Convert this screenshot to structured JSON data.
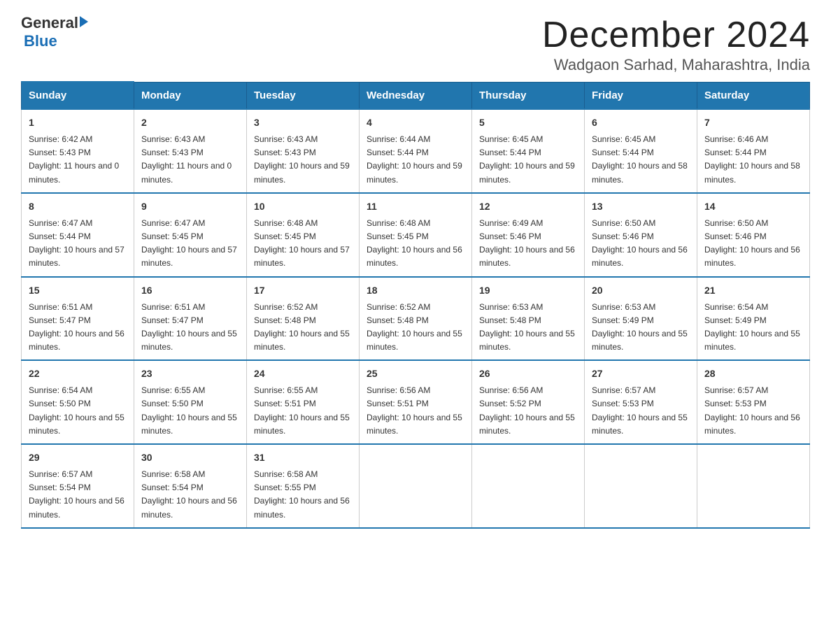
{
  "logo": {
    "general": "General",
    "blue": "Blue"
  },
  "title": "December 2024",
  "subtitle": "Wadgaon Sarhad, Maharashtra, India",
  "days_of_week": [
    "Sunday",
    "Monday",
    "Tuesday",
    "Wednesday",
    "Thursday",
    "Friday",
    "Saturday"
  ],
  "weeks": [
    [
      {
        "day": "1",
        "sunrise": "6:42 AM",
        "sunset": "5:43 PM",
        "daylight": "11 hours and 0 minutes."
      },
      {
        "day": "2",
        "sunrise": "6:43 AM",
        "sunset": "5:43 PM",
        "daylight": "11 hours and 0 minutes."
      },
      {
        "day": "3",
        "sunrise": "6:43 AM",
        "sunset": "5:43 PM",
        "daylight": "10 hours and 59 minutes."
      },
      {
        "day": "4",
        "sunrise": "6:44 AM",
        "sunset": "5:44 PM",
        "daylight": "10 hours and 59 minutes."
      },
      {
        "day": "5",
        "sunrise": "6:45 AM",
        "sunset": "5:44 PM",
        "daylight": "10 hours and 59 minutes."
      },
      {
        "day": "6",
        "sunrise": "6:45 AM",
        "sunset": "5:44 PM",
        "daylight": "10 hours and 58 minutes."
      },
      {
        "day": "7",
        "sunrise": "6:46 AM",
        "sunset": "5:44 PM",
        "daylight": "10 hours and 58 minutes."
      }
    ],
    [
      {
        "day": "8",
        "sunrise": "6:47 AM",
        "sunset": "5:44 PM",
        "daylight": "10 hours and 57 minutes."
      },
      {
        "day": "9",
        "sunrise": "6:47 AM",
        "sunset": "5:45 PM",
        "daylight": "10 hours and 57 minutes."
      },
      {
        "day": "10",
        "sunrise": "6:48 AM",
        "sunset": "5:45 PM",
        "daylight": "10 hours and 57 minutes."
      },
      {
        "day": "11",
        "sunrise": "6:48 AM",
        "sunset": "5:45 PM",
        "daylight": "10 hours and 56 minutes."
      },
      {
        "day": "12",
        "sunrise": "6:49 AM",
        "sunset": "5:46 PM",
        "daylight": "10 hours and 56 minutes."
      },
      {
        "day": "13",
        "sunrise": "6:50 AM",
        "sunset": "5:46 PM",
        "daylight": "10 hours and 56 minutes."
      },
      {
        "day": "14",
        "sunrise": "6:50 AM",
        "sunset": "5:46 PM",
        "daylight": "10 hours and 56 minutes."
      }
    ],
    [
      {
        "day": "15",
        "sunrise": "6:51 AM",
        "sunset": "5:47 PM",
        "daylight": "10 hours and 56 minutes."
      },
      {
        "day": "16",
        "sunrise": "6:51 AM",
        "sunset": "5:47 PM",
        "daylight": "10 hours and 55 minutes."
      },
      {
        "day": "17",
        "sunrise": "6:52 AM",
        "sunset": "5:48 PM",
        "daylight": "10 hours and 55 minutes."
      },
      {
        "day": "18",
        "sunrise": "6:52 AM",
        "sunset": "5:48 PM",
        "daylight": "10 hours and 55 minutes."
      },
      {
        "day": "19",
        "sunrise": "6:53 AM",
        "sunset": "5:48 PM",
        "daylight": "10 hours and 55 minutes."
      },
      {
        "day": "20",
        "sunrise": "6:53 AM",
        "sunset": "5:49 PM",
        "daylight": "10 hours and 55 minutes."
      },
      {
        "day": "21",
        "sunrise": "6:54 AM",
        "sunset": "5:49 PM",
        "daylight": "10 hours and 55 minutes."
      }
    ],
    [
      {
        "day": "22",
        "sunrise": "6:54 AM",
        "sunset": "5:50 PM",
        "daylight": "10 hours and 55 minutes."
      },
      {
        "day": "23",
        "sunrise": "6:55 AM",
        "sunset": "5:50 PM",
        "daylight": "10 hours and 55 minutes."
      },
      {
        "day": "24",
        "sunrise": "6:55 AM",
        "sunset": "5:51 PM",
        "daylight": "10 hours and 55 minutes."
      },
      {
        "day": "25",
        "sunrise": "6:56 AM",
        "sunset": "5:51 PM",
        "daylight": "10 hours and 55 minutes."
      },
      {
        "day": "26",
        "sunrise": "6:56 AM",
        "sunset": "5:52 PM",
        "daylight": "10 hours and 55 minutes."
      },
      {
        "day": "27",
        "sunrise": "6:57 AM",
        "sunset": "5:53 PM",
        "daylight": "10 hours and 55 minutes."
      },
      {
        "day": "28",
        "sunrise": "6:57 AM",
        "sunset": "5:53 PM",
        "daylight": "10 hours and 56 minutes."
      }
    ],
    [
      {
        "day": "29",
        "sunrise": "6:57 AM",
        "sunset": "5:54 PM",
        "daylight": "10 hours and 56 minutes."
      },
      {
        "day": "30",
        "sunrise": "6:58 AM",
        "sunset": "5:54 PM",
        "daylight": "10 hours and 56 minutes."
      },
      {
        "day": "31",
        "sunrise": "6:58 AM",
        "sunset": "5:55 PM",
        "daylight": "10 hours and 56 minutes."
      },
      null,
      null,
      null,
      null
    ]
  ]
}
